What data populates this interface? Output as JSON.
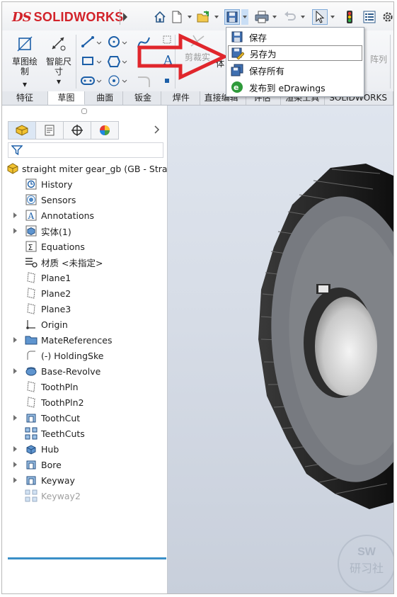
{
  "app": {
    "logo_mark": "DS",
    "logo_text": "SOLIDWORKS"
  },
  "ribbon": {
    "sketch_label": "草图绘制",
    "smart_dim_label_1": "智能尺",
    "smart_dim_label_2": "寸",
    "trim_label": "剪裁实",
    "linear_pattern_label": "阵列",
    "clipped_left_label": "体"
  },
  "tabs": [
    {
      "label": "特征"
    },
    {
      "label": "草图"
    },
    {
      "label": "曲面"
    },
    {
      "label": "钣金"
    },
    {
      "label": "焊件"
    },
    {
      "label": "直接编辑"
    },
    {
      "label": "评估"
    },
    {
      "label": "渲染工具"
    },
    {
      "label": "SOLIDWORKS"
    }
  ],
  "active_tab_index": 1,
  "save_menu": {
    "items": [
      {
        "label": "保存"
      },
      {
        "label": "另存为"
      },
      {
        "label": "保存所有"
      },
      {
        "label": "发布到 eDrawings"
      }
    ],
    "hover_index": 1
  },
  "feature_tree": {
    "root_label": "straight miter gear_gb  (GB - Straig",
    "items": [
      {
        "label": "History",
        "icon": "history-icon",
        "expandable": false
      },
      {
        "label": "Sensors",
        "icon": "sensors-icon",
        "expandable": false
      },
      {
        "label": "Annotations",
        "icon": "annotations-icon",
        "expandable": true
      },
      {
        "label": "实体(1)",
        "icon": "solid-bodies-icon",
        "expandable": true
      },
      {
        "label": "Equations",
        "icon": "equations-icon",
        "expandable": false
      },
      {
        "label": "材质 <未指定>",
        "icon": "material-icon",
        "expandable": false
      },
      {
        "label": "Plane1",
        "icon": "plane-icon",
        "expandable": false
      },
      {
        "label": "Plane2",
        "icon": "plane-icon",
        "expandable": false
      },
      {
        "label": "Plane3",
        "icon": "plane-icon",
        "expandable": false
      },
      {
        "label": "Origin",
        "icon": "origin-icon",
        "expandable": false
      },
      {
        "label": "MateReferences",
        "icon": "folder-icon",
        "expandable": true
      },
      {
        "label": "(-) HoldingSke",
        "icon": "sketch-icon",
        "expandable": false
      },
      {
        "label": "Base-Revolve",
        "icon": "revolve-icon",
        "expandable": true
      },
      {
        "label": "ToothPln",
        "icon": "plane-icon",
        "expandable": false
      },
      {
        "label": "ToothPln2",
        "icon": "plane-icon",
        "expandable": false
      },
      {
        "label": "ToothCut",
        "icon": "cut-icon",
        "expandable": true
      },
      {
        "label": "TeethCuts",
        "icon": "pattern-icon",
        "expandable": false
      },
      {
        "label": "Hub",
        "icon": "extrude-icon",
        "expandable": true
      },
      {
        "label": "Bore",
        "icon": "cut-icon",
        "expandable": true
      },
      {
        "label": "Keyway",
        "icon": "cut-icon",
        "expandable": true
      },
      {
        "label": "Keyway2",
        "icon": "pattern-icon",
        "expandable": false,
        "rolled_back": true
      }
    ]
  },
  "watermark": {
    "line1": "SW",
    "line2": "研习社"
  },
  "colors": {
    "brand_red": "#d2232a",
    "accent_blue": "#3a8fc7",
    "arrow_red": "#e0262c"
  }
}
